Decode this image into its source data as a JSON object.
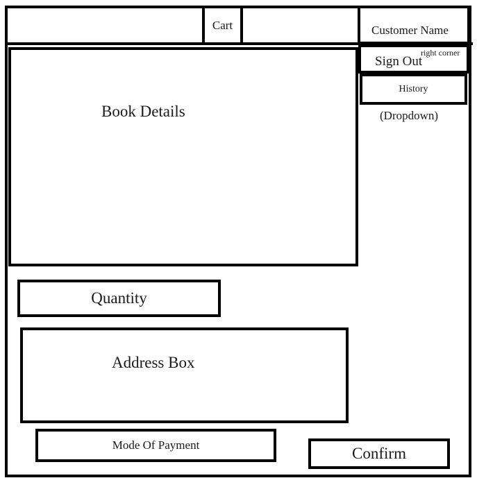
{
  "header": {
    "cart_label": "Cart",
    "customer_name_label": "Customer Name",
    "sign_out_label": "Sign Out",
    "sign_out_note": "right corner",
    "history_label": "History",
    "history_note": "(Dropdown)"
  },
  "main": {
    "book_details_label": "Book Details",
    "quantity_label": "Quantity",
    "address_label": "Address Box",
    "payment_label": "Mode Of Payment",
    "confirm_label": "Confirm"
  }
}
